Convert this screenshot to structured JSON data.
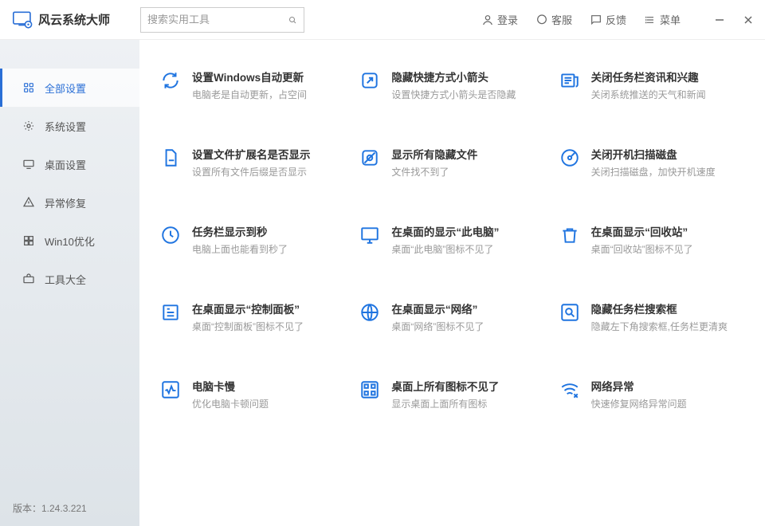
{
  "app": {
    "name": "风云系统大师"
  },
  "search": {
    "placeholder": "搜索实用工具"
  },
  "topActions": {
    "login": "登录",
    "support": "客服",
    "feedback": "反馈",
    "menu": "菜单"
  },
  "sidebar": {
    "items": [
      {
        "label": "全部设置"
      },
      {
        "label": "系统设置"
      },
      {
        "label": "桌面设置"
      },
      {
        "label": "异常修复"
      },
      {
        "label": "Win10优化"
      },
      {
        "label": "工具大全"
      }
    ],
    "version": "版本：1.24.3.221"
  },
  "cards": [
    {
      "title": "设置Windows自动更新",
      "desc": "电脑老是自动更新，占空间"
    },
    {
      "title": "隐藏快捷方式小箭头",
      "desc": "设置快捷方式小箭头是否隐藏"
    },
    {
      "title": "关闭任务栏资讯和兴趣",
      "desc": "关闭系统推送的天气和新闻"
    },
    {
      "title": "设置文件扩展名是否显示",
      "desc": "设置所有文件后缀是否显示"
    },
    {
      "title": "显示所有隐藏文件",
      "desc": "文件找不到了"
    },
    {
      "title": "关闭开机扫描磁盘",
      "desc": "关闭扫描磁盘，加快开机速度"
    },
    {
      "title": "任务栏显示到秒",
      "desc": "电脑上面也能看到秒了"
    },
    {
      "title": "在桌面的显示“此电脑”",
      "desc": "桌面“此电脑”图标不见了"
    },
    {
      "title": "在桌面显示“回收站”",
      "desc": "桌面“回收站”图标不见了"
    },
    {
      "title": "在桌面显示“控制面板”",
      "desc": "桌面“控制面板”图标不见了"
    },
    {
      "title": "在桌面显示“网络”",
      "desc": "桌面“网络”图标不见了"
    },
    {
      "title": "隐藏任务栏搜索框",
      "desc": "隐藏左下角搜索框,任务栏更清爽"
    },
    {
      "title": "电脑卡慢",
      "desc": "优化电脑卡顿问题"
    },
    {
      "title": "桌面上所有图标不见了",
      "desc": "显示桌面上面所有图标"
    },
    {
      "title": "网络异常",
      "desc": "快速修复网络异常问题"
    }
  ]
}
